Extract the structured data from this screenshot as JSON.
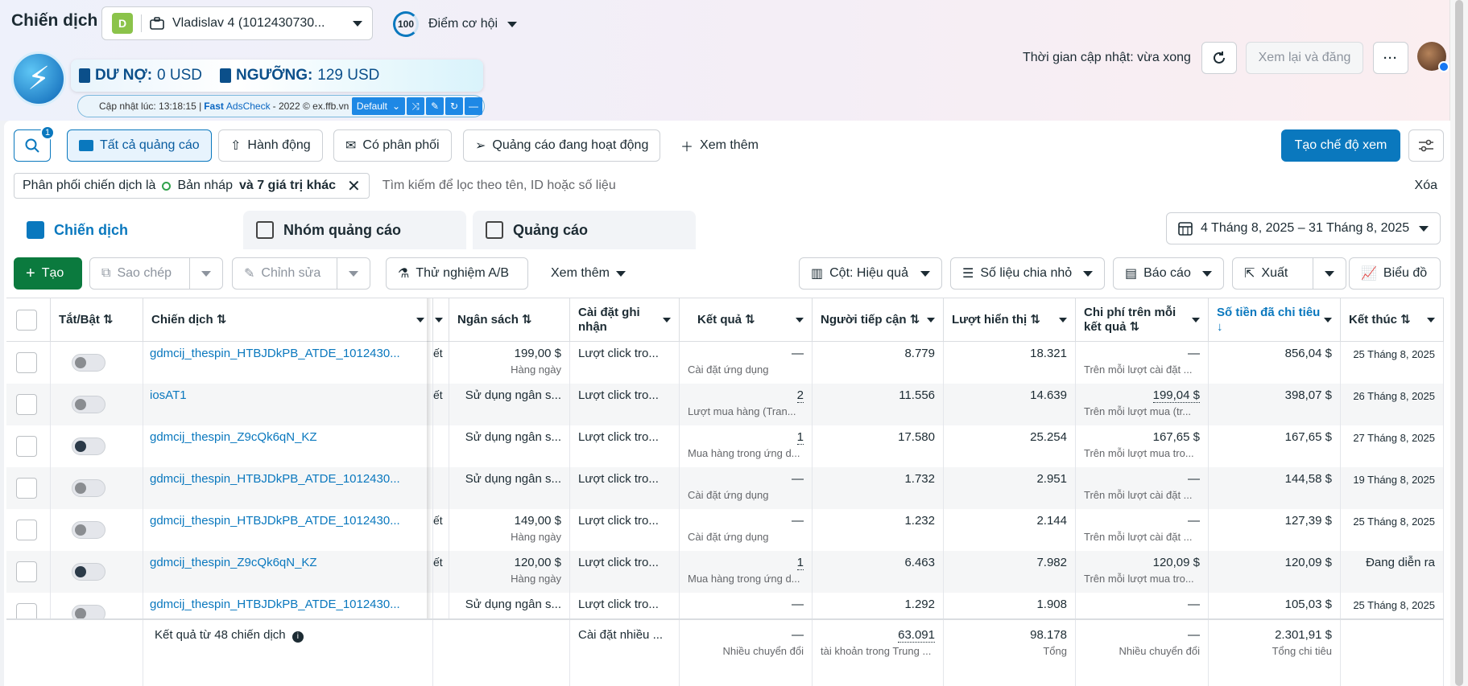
{
  "header": {
    "title": "Chiến dịch",
    "account_badge": "D",
    "account_name": "Vladislav 4 (1012430730...",
    "opportunity_score": "100",
    "opportunity_label": "Điểm cơ hội",
    "update_time": "Thời gian cập nhật: vừa xong",
    "review_button": "Xem lại và đăng",
    "more_button": "···"
  },
  "extension": {
    "debt_label": "DƯ NỢ:",
    "debt_value": "0 USD",
    "threshold_label": "NGƯỠNG:",
    "threshold_value": "129 USD",
    "updated_at": "Cập nhật lúc: 13:18:15 |",
    "brand_fast": "Fast",
    "brand_ads": "AdsCheck",
    "copyright": "- 2022 © ex.ffb.vn",
    "preset": "Default"
  },
  "filters": {
    "search_badge": "1",
    "buttons": [
      "Tất cả quảng cáo",
      "Hành động",
      "Có phân phối",
      "Quảng cáo đang hoạt động",
      "Xem thêm"
    ],
    "create_view": "Tạo chế độ xem",
    "chip_prefix": "Phân phối chiến dịch là",
    "chip_value": "Bản nháp",
    "chip_more": "và 7 giá trị khác",
    "search_placeholder": "Tìm kiếm để lọc theo tên, ID hoặc số liệu",
    "clear": "Xóa"
  },
  "tabs": [
    "Chiến dịch",
    "Nhóm quảng cáo",
    "Quảng cáo"
  ],
  "date_range": "4 Tháng 8, 2025 – 31 Tháng 8, 2025",
  "toolbar": {
    "create": "Tạo",
    "copy": "Sao chép",
    "edit": "Chỉnh sửa",
    "ab_test": "Thử nghiệm A/B",
    "see_more": "Xem thêm",
    "columns": "Cột: Hiệu quả",
    "breakdown": "Số liệu chia nhỏ",
    "reports": "Báo cáo",
    "export": "Xuất",
    "chart": "Biểu đồ"
  },
  "table": {
    "headers": {
      "toggle": "Tắt/Bật ⇅",
      "campaign": "Chiến dịch ⇅",
      "budget": "Ngân sách ⇅",
      "attribution": "Cài đặt ghi nhận",
      "results": "Kết quả ⇅",
      "reach": "Người tiếp cận ⇅",
      "impressions": "Lượt hiển thị ⇅",
      "cost_per_result": "Chi phí trên mỗi kết quả ⇅",
      "amount_spent": "Số tiền đã chi tiêu ↓",
      "ends": "Kết thúc ⇅"
    },
    "rows": [
      {
        "on": false,
        "name": "gdmcij_thespin_HTBJDkPB_ATDE_1012430...",
        "edge": "ết",
        "budget": "199,00 $",
        "budget_sub": "Hàng ngày",
        "attribution": "Lượt click tro...",
        "result": "—",
        "result_sub": "Cài đặt ứng dụng",
        "reach": "8.779",
        "impressions": "18.321",
        "cpr": "—",
        "cpr_sub": "Trên mỗi lượt cài đặt ...",
        "spent": "856,04 $",
        "ends": "25 Tháng 8, 2025"
      },
      {
        "on": false,
        "name": "iosAT1",
        "edge": "ết",
        "budget": "Sử dụng ngân s...",
        "budget_sub": "",
        "attribution": "Lượt click tro...",
        "result": "2",
        "result_sub": "Lượt mua hàng (Tran...",
        "reach": "11.556",
        "impressions": "14.639",
        "cpr": "199,04 $",
        "cpr_sub": "Trên mỗi lượt mua (tr...",
        "spent": "398,07 $",
        "ends": "26 Tháng 8, 2025"
      },
      {
        "on": true,
        "name": "gdmcij_thespin_Z9cQk6qN_KZ",
        "edge": "",
        "budget": "Sử dụng ngân s...",
        "budget_sub": "",
        "attribution": "Lượt click tro...",
        "result": "1",
        "result_sub": "Mua hàng trong ứng d...",
        "reach": "17.580",
        "impressions": "25.254",
        "cpr": "167,65 $",
        "cpr_sub": "Trên mỗi lượt mua tro...",
        "spent": "167,65 $",
        "ends": "27 Tháng 8, 2025"
      },
      {
        "on": false,
        "name": "gdmcij_thespin_HTBJDkPB_ATDE_1012430...",
        "edge": "",
        "budget": "Sử dụng ngân s...",
        "budget_sub": "",
        "attribution": "Lượt click tro...",
        "result": "—",
        "result_sub": "Cài đặt ứng dụng",
        "reach": "1.732",
        "impressions": "2.951",
        "cpr": "—",
        "cpr_sub": "Trên mỗi lượt cài đặt ...",
        "spent": "144,58 $",
        "ends": "19 Tháng 8, 2025"
      },
      {
        "on": false,
        "name": "gdmcij_thespin_HTBJDkPB_ATDE_1012430...",
        "edge": "ết",
        "budget": "149,00 $",
        "budget_sub": "Hàng ngày",
        "attribution": "Lượt click tro...",
        "result": "—",
        "result_sub": "Cài đặt ứng dụng",
        "reach": "1.232",
        "impressions": "2.144",
        "cpr": "—",
        "cpr_sub": "Trên mỗi lượt cài đặt ...",
        "spent": "127,39 $",
        "ends": "25 Tháng 8, 2025"
      },
      {
        "on": true,
        "name": "gdmcij_thespin_Z9cQk6qN_KZ",
        "edge": "ết",
        "budget": "120,00 $",
        "budget_sub": "Hàng ngày",
        "attribution": "Lượt click tro...",
        "result": "1",
        "result_sub": "Mua hàng trong ứng d...",
        "reach": "6.463",
        "impressions": "7.982",
        "cpr": "120,09 $",
        "cpr_sub": "Trên mỗi lượt mua tro...",
        "spent": "120,09 $",
        "ends": "Đang diễn ra"
      },
      {
        "on": false,
        "name": "gdmcij_thespin_HTBJDkPB_ATDE_1012430...",
        "edge": "",
        "budget": "Sử dụng ngân s...",
        "budget_sub": "",
        "attribution": "Lượt click tro...",
        "result": "—",
        "result_sub": "",
        "reach": "1.292",
        "impressions": "1.908",
        "cpr": "—",
        "cpr_sub": "",
        "spent": "105,03 $",
        "ends": "25 Tháng 8, 2025"
      }
    ],
    "summary": {
      "label": "Kết quả từ 48 chiến dịch",
      "attribution": "Cài đặt nhiều ...",
      "result": "—",
      "result_sub": "Nhiều chuyển đổi",
      "reach": "63.091",
      "reach_sub": "tài khoản trong Trung ...",
      "impressions": "98.178",
      "impressions_sub": "Tổng",
      "cpr": "—",
      "cpr_sub": "Nhiều chuyển đổi",
      "spent": "2.301,91 $",
      "spent_sub": "Tổng chi tiêu"
    }
  }
}
